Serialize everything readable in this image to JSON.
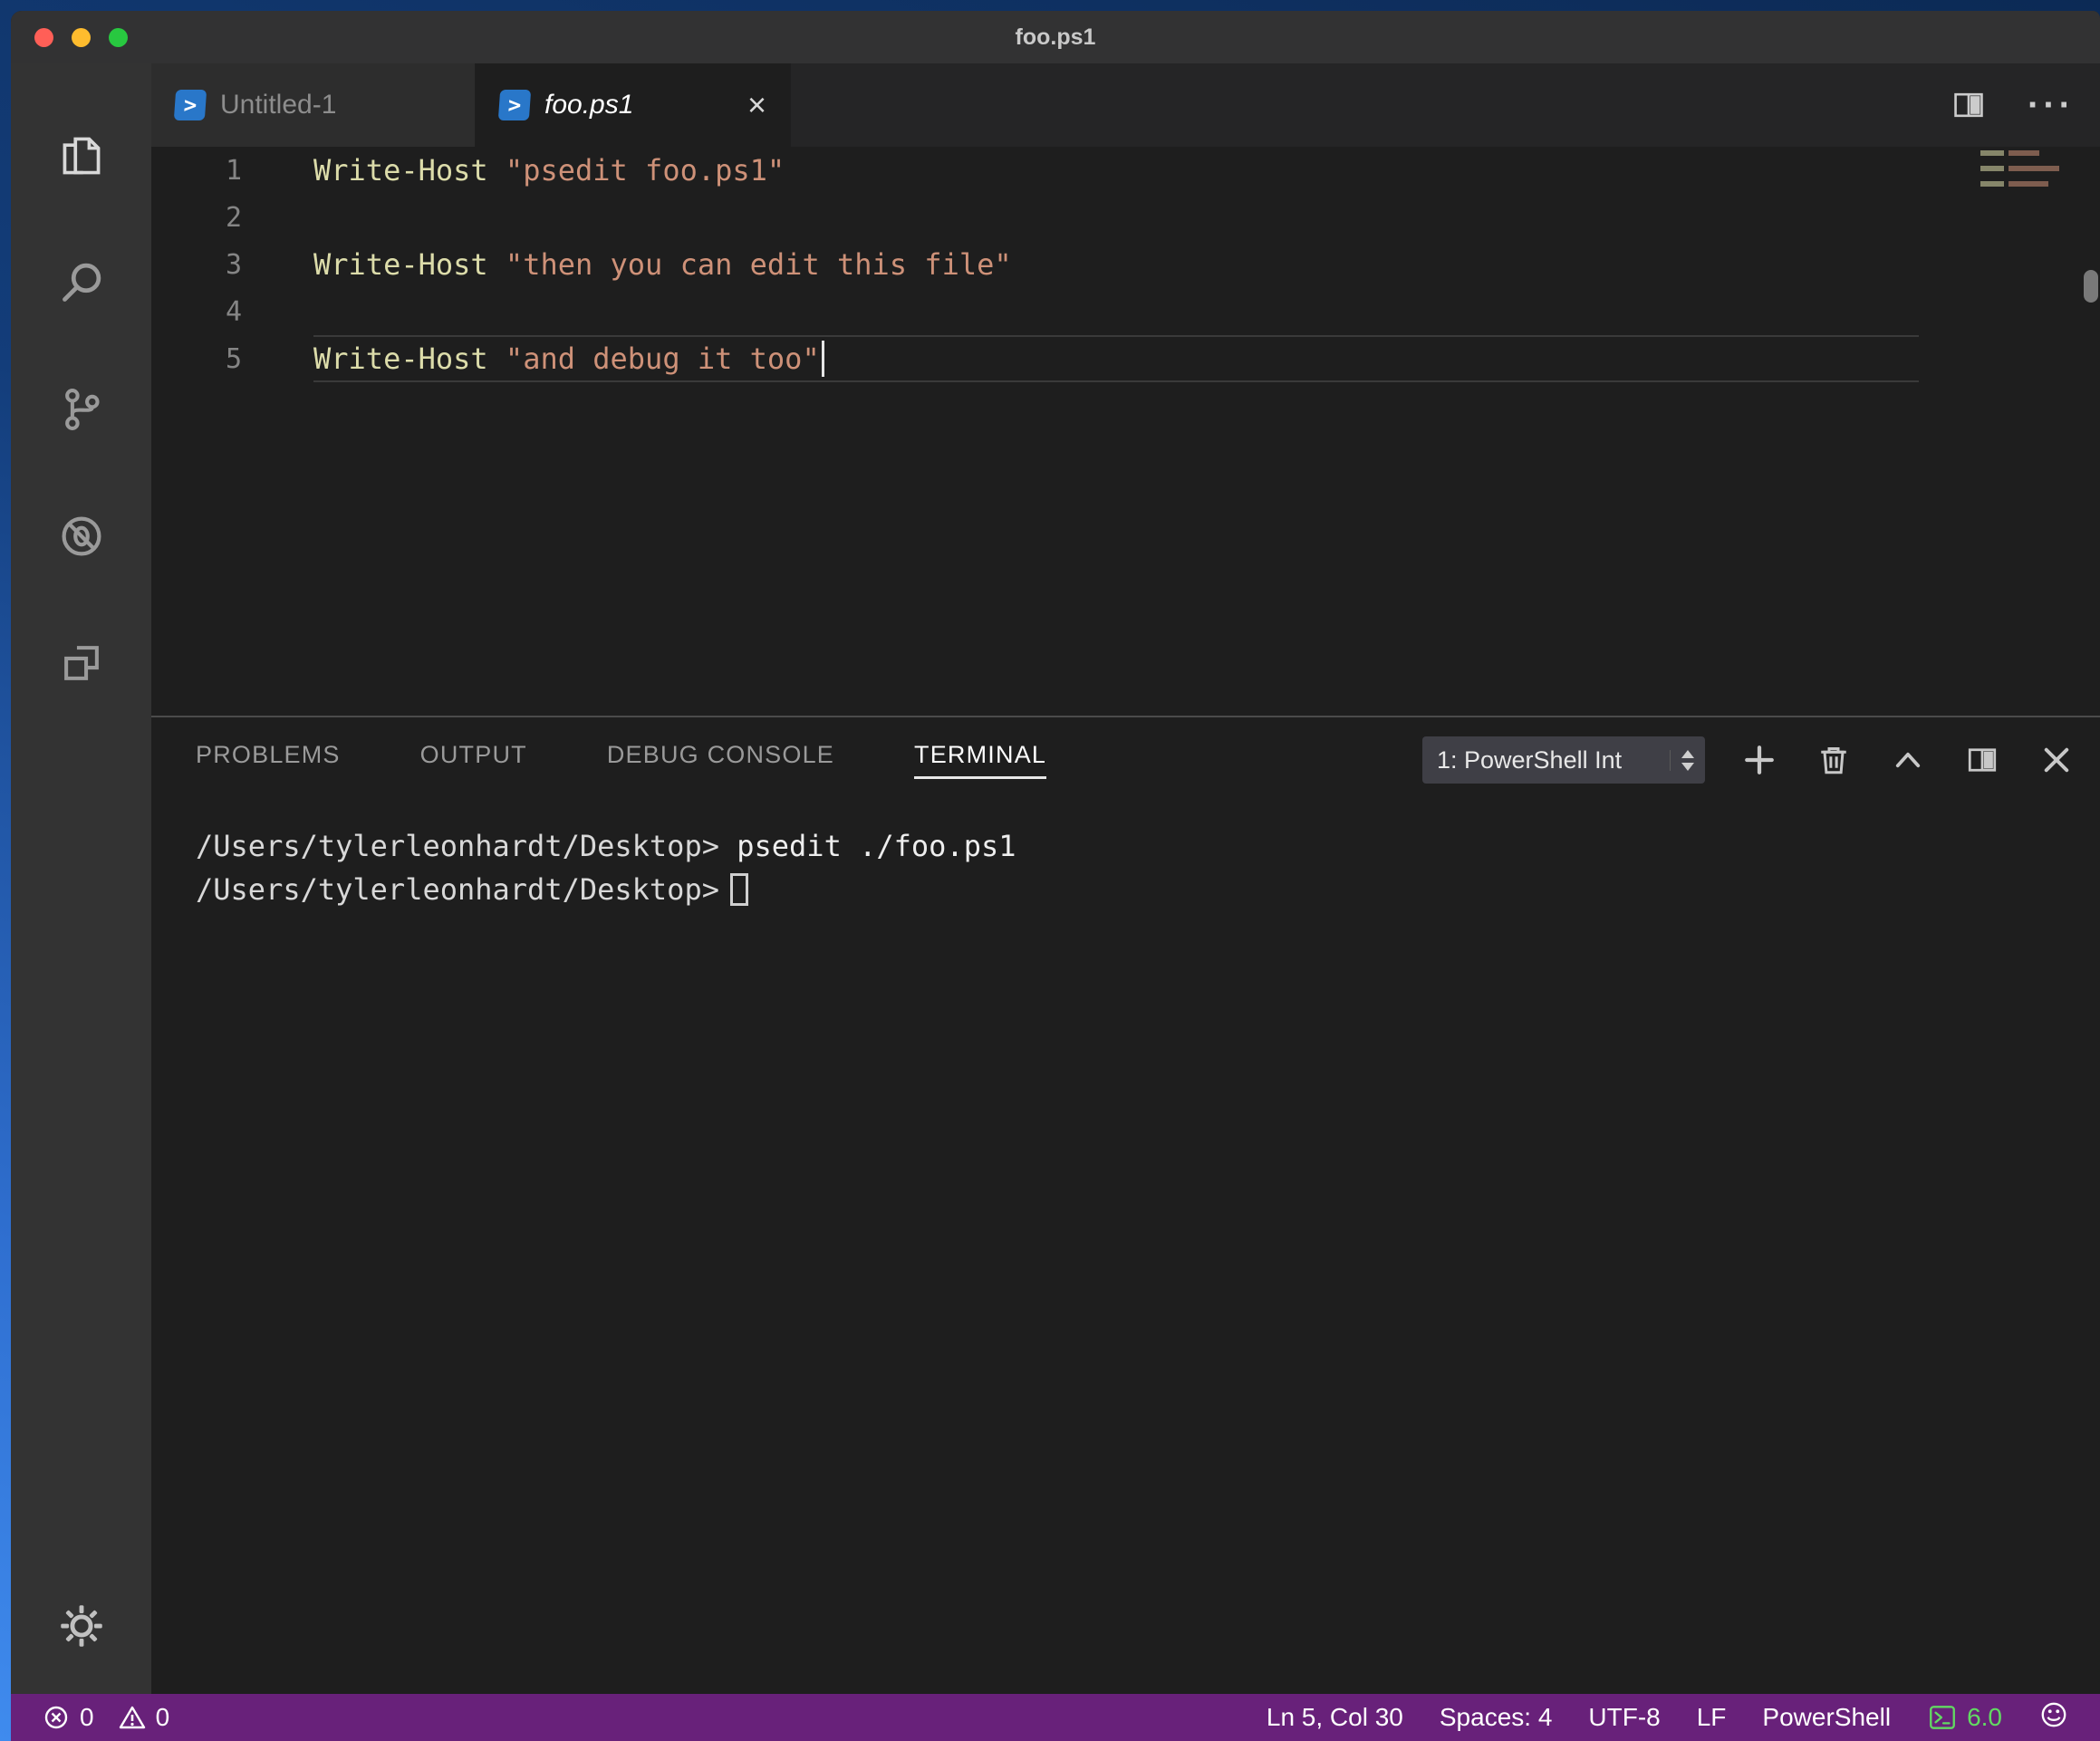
{
  "colors": {
    "status_bar_bg": "#68217A",
    "powershell_blue": "#2977C9",
    "token_command": "#DCDCAA",
    "token_string": "#CE9178",
    "version_green": "#62D962",
    "editor_bg": "#1E1E1E",
    "activity_bar_bg": "#333333"
  },
  "window": {
    "title": "foo.ps1"
  },
  "tab_bar": {
    "ps_glyph": ">",
    "tabs": [
      {
        "label": "Untitled-1",
        "active": false
      },
      {
        "label": "foo.ps1",
        "active": true
      }
    ],
    "close_tab_glyph": "×",
    "more_actions_glyph": "···"
  },
  "editor": {
    "cursor_line": 5,
    "lines": [
      {
        "num": "1",
        "cmd": "Write-Host",
        "str": " \"psedit foo.ps1\""
      },
      {
        "num": "2",
        "cmd": "",
        "str": ""
      },
      {
        "num": "3",
        "cmd": "Write-Host",
        "str": " \"then you can edit this file\""
      },
      {
        "num": "4",
        "cmd": "",
        "str": ""
      },
      {
        "num": "5",
        "cmd": "Write-Host",
        "str": " \"and debug it too\""
      }
    ]
  },
  "panel": {
    "tabs": [
      {
        "label": "PROBLEMS",
        "active": false
      },
      {
        "label": "OUTPUT",
        "active": false
      },
      {
        "label": "DEBUG CONSOLE",
        "active": false
      },
      {
        "label": "TERMINAL",
        "active": true
      }
    ],
    "terminal_selector": "1: PowerShell Int"
  },
  "terminal": {
    "lines": [
      {
        "prompt": "/Users/tylerleonhardt/Desktop>",
        "command": " psedit ./foo.ps1"
      },
      {
        "prompt": "/Users/tylerleonhardt/Desktop>",
        "command": ""
      }
    ]
  },
  "status_bar": {
    "errors": "0",
    "warnings": "0",
    "cursor_position": "Ln 5, Col 30",
    "indentation": "Spaces: 4",
    "encoding": "UTF-8",
    "eol": "LF",
    "language": "PowerShell",
    "version": "6.0"
  },
  "icons": {
    "activity_bar": [
      "explorer",
      "search",
      "source-control",
      "debug",
      "extensions",
      "settings-gear"
    ],
    "tab_actions": [
      "split-editor",
      "more-actions"
    ],
    "panel_actions": [
      "new-terminal",
      "kill-terminal",
      "maximize-panel",
      "split-terminal",
      "close-panel"
    ],
    "status": [
      "errors",
      "warnings",
      "powershell-terminal",
      "smiley-feedback"
    ]
  }
}
